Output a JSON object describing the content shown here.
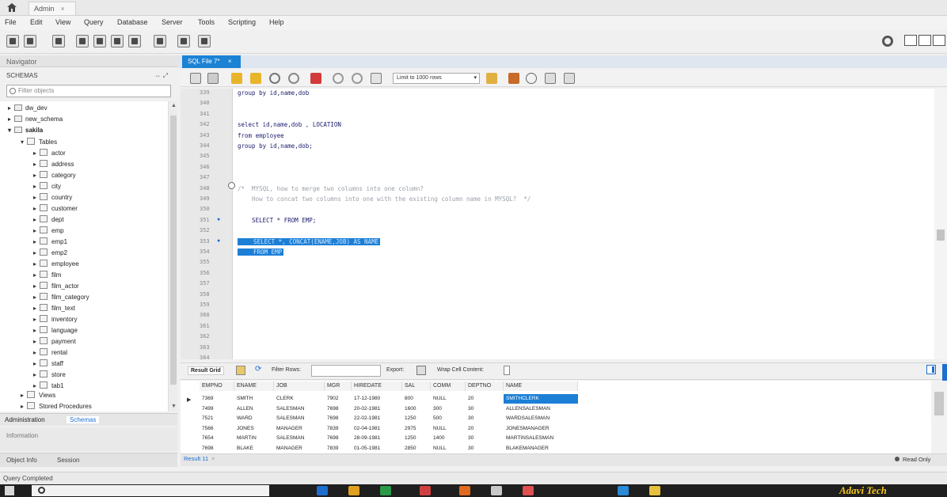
{
  "window": {
    "tab_title": "Admin",
    "close_glyph": "×"
  },
  "menu": [
    "File",
    "Edit",
    "View",
    "Query",
    "Database",
    "Server",
    "Tools",
    "Scripting",
    "Help"
  ],
  "navigator": {
    "header": "Navigator",
    "schemas_label": "SCHEMAS",
    "schemas_icons": "⇔ ⤢",
    "filter_placeholder": "Filter objects",
    "schemas": [
      {
        "name": "dw_dev",
        "expanded": false
      },
      {
        "name": "new_schema",
        "expanded": false
      },
      {
        "name": "sakila",
        "expanded": true
      }
    ],
    "tables_label": "Tables",
    "tables": [
      "actor",
      "address",
      "category",
      "city",
      "country",
      "customer",
      "dept",
      "emp",
      "emp1",
      "emp2",
      "employee",
      "film",
      "film_actor",
      "film_category",
      "film_text",
      "inventory",
      "language",
      "payment",
      "rental",
      "staff",
      "store",
      "tab1"
    ],
    "views_label": "Views",
    "procedures_label": "Stored Procedures",
    "subtabs": {
      "admin": "Administration",
      "schemas": "Schemas"
    },
    "info_label": "Information",
    "bottom_tabs": {
      "object_info": "Object Info",
      "session": "Session"
    }
  },
  "editor": {
    "tab_label": "SQL File 7*",
    "tab_close": "×",
    "limit_select": "Limit to 1000 rows",
    "lines": [
      {
        "n": "339",
        "text": "group by id,name,dob",
        "kind": "code"
      },
      {
        "n": "340",
        "text": "",
        "kind": "code"
      },
      {
        "n": "341",
        "text": "",
        "kind": "code"
      },
      {
        "n": "342",
        "text": "select id,name,dob , LOCATION",
        "kind": "code"
      },
      {
        "n": "343",
        "text": "from employee",
        "kind": "code"
      },
      {
        "n": "344",
        "text": "group by id,name,dob;",
        "kind": "code"
      },
      {
        "n": "345",
        "text": "",
        "kind": "code"
      },
      {
        "n": "346",
        "text": "",
        "kind": "code"
      },
      {
        "n": "347",
        "text": "",
        "kind": "code"
      },
      {
        "n": "348",
        "text": "/*  MYSQL, how to merge two columns into one column?",
        "kind": "comment"
      },
      {
        "n": "349",
        "text": "    How to concat two columns into one with the existing column name in MYSQL?  */",
        "kind": "comment"
      },
      {
        "n": "350",
        "text": "",
        "kind": "code"
      },
      {
        "n": "351",
        "text": "    SELECT * FROM EMP;",
        "kind": "code"
      },
      {
        "n": "352",
        "text": "",
        "kind": "code"
      },
      {
        "n": "353",
        "text": "    SELECT *, CONCAT(ENAME,JOB) AS NAME",
        "kind": "sel"
      },
      {
        "n": "354",
        "text": "    FROM EMP",
        "kind": "sel"
      },
      {
        "n": "355",
        "text": "",
        "kind": "code"
      },
      {
        "n": "356",
        "text": "",
        "kind": "code"
      },
      {
        "n": "357",
        "text": "",
        "kind": "code"
      },
      {
        "n": "358",
        "text": "",
        "kind": "code"
      },
      {
        "n": "359",
        "text": "",
        "kind": "code"
      },
      {
        "n": "360",
        "text": "",
        "kind": "code"
      },
      {
        "n": "361",
        "text": "",
        "kind": "code"
      },
      {
        "n": "362",
        "text": "",
        "kind": "code"
      },
      {
        "n": "363",
        "text": "",
        "kind": "code"
      },
      {
        "n": "364",
        "text": "",
        "kind": "code"
      }
    ]
  },
  "results": {
    "grid_label": "Result Grid",
    "filter_label": "Filter Rows:",
    "export_label": "Export:",
    "wrap_label": "Wrap Cell Content:",
    "columns": [
      "EMPNO",
      "ENAME",
      "JOB",
      "MGR",
      "HIREDATE",
      "SAL",
      "COMM",
      "DEPTNO",
      "NAME"
    ],
    "rows": [
      [
        "7369",
        "SMITH",
        "CLERK",
        "7902",
        "17-12-1980",
        "800",
        "NULL",
        "20",
        "SMITHCLERK"
      ],
      [
        "7499",
        "ALLEN",
        "SALESMAN",
        "7698",
        "20-02-1981",
        "1600",
        "300",
        "30",
        "ALLENSALESMAN"
      ],
      [
        "7521",
        "WARD",
        "SALESMAN",
        "7698",
        "22-02-1981",
        "1250",
        "500",
        "30",
        "WARDSALESMAN"
      ],
      [
        "7566",
        "JONES",
        "MANAGER",
        "7839",
        "02-04-1981",
        "2975",
        "NULL",
        "20",
        "JONESMANAGER"
      ],
      [
        "7654",
        "MARTIN",
        "SALESMAN",
        "7698",
        "28-09-1981",
        "1250",
        "1400",
        "30",
        "MARTINSALESMAN"
      ],
      [
        "7698",
        "BLAKE",
        "MANAGER",
        "7839",
        "01-05-1981",
        "2850",
        "NULL",
        "30",
        "BLAKEMANAGER"
      ]
    ],
    "result_tab": "Result 11",
    "result_tab_close": "×",
    "readonly": "Read Only",
    "row_pointer": "▶"
  },
  "status": {
    "text": "Query Completed"
  },
  "taskbar": {
    "watermark": "Adavi Tech"
  },
  "colors": {
    "accent": "#1c7fd6",
    "selection": "#1c7fd6"
  }
}
